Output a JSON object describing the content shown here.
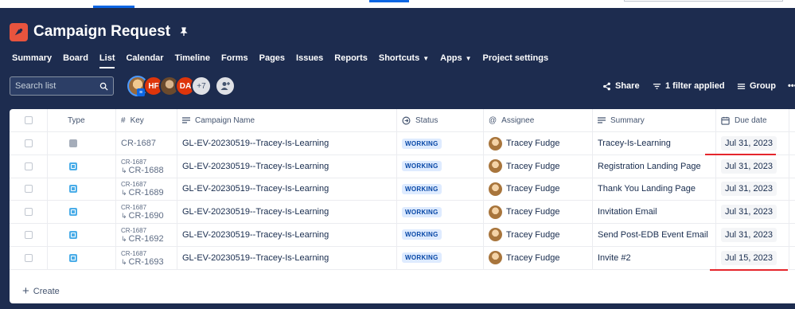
{
  "project": {
    "title": "Campaign Request"
  },
  "nav": {
    "items": [
      {
        "label": "Summary"
      },
      {
        "label": "Board"
      },
      {
        "label": "List"
      },
      {
        "label": "Calendar"
      },
      {
        "label": "Timeline"
      },
      {
        "label": "Forms"
      },
      {
        "label": "Pages"
      },
      {
        "label": "Issues"
      },
      {
        "label": "Reports"
      },
      {
        "label": "Shortcuts"
      },
      {
        "label": "Apps"
      },
      {
        "label": "Project settings"
      }
    ],
    "active": "List"
  },
  "toolbar": {
    "search_placeholder": "Search list",
    "avatars": [
      "HF",
      "DA"
    ],
    "more_count": "+7",
    "share_label": "Share",
    "filter_label": "1 filter applied",
    "group_label": "Group"
  },
  "table": {
    "columns": [
      "Type",
      "Key",
      "Campaign Name",
      "Status",
      "Assignee",
      "Summary",
      "Due date"
    ],
    "rows": [
      {
        "type": "epic",
        "parent": "",
        "key": "CR-1687",
        "campaign": "GL-EV-20230519--Tracey-Is-Learning",
        "status": "WORKING",
        "assignee": "Tracey Fudge",
        "summary": "Tracey-Is-Learning",
        "due": "Jul 31, 2023"
      },
      {
        "type": "subtask",
        "parent": "CR-1687",
        "key": "CR-1688",
        "campaign": "GL-EV-20230519--Tracey-Is-Learning",
        "status": "WORKING",
        "assignee": "Tracey Fudge",
        "summary": "Registration Landing Page",
        "due": "Jul 31, 2023"
      },
      {
        "type": "subtask",
        "parent": "CR-1687",
        "key": "CR-1689",
        "campaign": "GL-EV-20230519--Tracey-Is-Learning",
        "status": "WORKING",
        "assignee": "Tracey Fudge",
        "summary": "Thank You Landing Page",
        "due": "Jul 31, 2023"
      },
      {
        "type": "subtask",
        "parent": "CR-1687",
        "key": "CR-1690",
        "campaign": "GL-EV-20230519--Tracey-Is-Learning",
        "status": "WORKING",
        "assignee": "Tracey Fudge",
        "summary": "Invitation Email",
        "due": "Jul 31, 2023"
      },
      {
        "type": "subtask",
        "parent": "CR-1687",
        "key": "CR-1692",
        "campaign": "GL-EV-20230519--Tracey-Is-Learning",
        "status": "WORKING",
        "assignee": "Tracey Fudge",
        "summary": "Send Post-EDB Event Email",
        "due": "Jul 31, 2023"
      },
      {
        "type": "subtask",
        "parent": "CR-1687",
        "key": "CR-1693",
        "campaign": "GL-EV-20230519--Tracey-Is-Learning",
        "status": "WORKING",
        "assignee": "Tracey Fudge",
        "summary": "Invite #2",
        "due": "Jul 15, 2023"
      }
    ],
    "create_label": "Create"
  },
  "colors": {
    "header_bg": "#1d2c4f",
    "accent": "#0c66e4",
    "annotation": "#e5262c",
    "lozenge_bg": "#deebff",
    "lozenge_text": "#0747a6"
  }
}
